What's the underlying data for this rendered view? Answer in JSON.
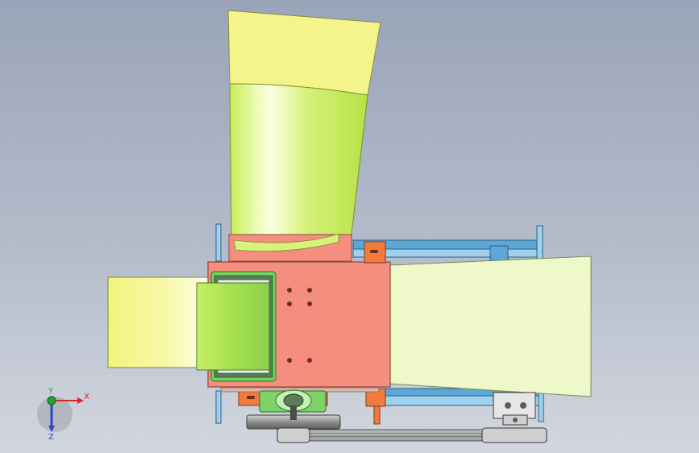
{
  "viewport": {
    "background_top": "#9aa4b8",
    "background_bottom": "#d2d6de"
  },
  "model": {
    "colors": {
      "hopper_yellow": "#f3f48a",
      "hopper_green": "#c8ef5e",
      "housing_salmon": "#f58e7e",
      "frame_blue": "#5da7d6",
      "bracket_orange": "#f07b3c",
      "chute_pale": "#eef8c8",
      "window_green": "#74d35e",
      "pulley_gray": "#8e8e8e",
      "bearing_green": "#7ed26a"
    }
  },
  "triad": {
    "x_label": "X",
    "y_label": "Y",
    "z_label": "Z",
    "x_color": "#d82626",
    "y_color": "#1fa82c",
    "z_color": "#2746c9"
  }
}
